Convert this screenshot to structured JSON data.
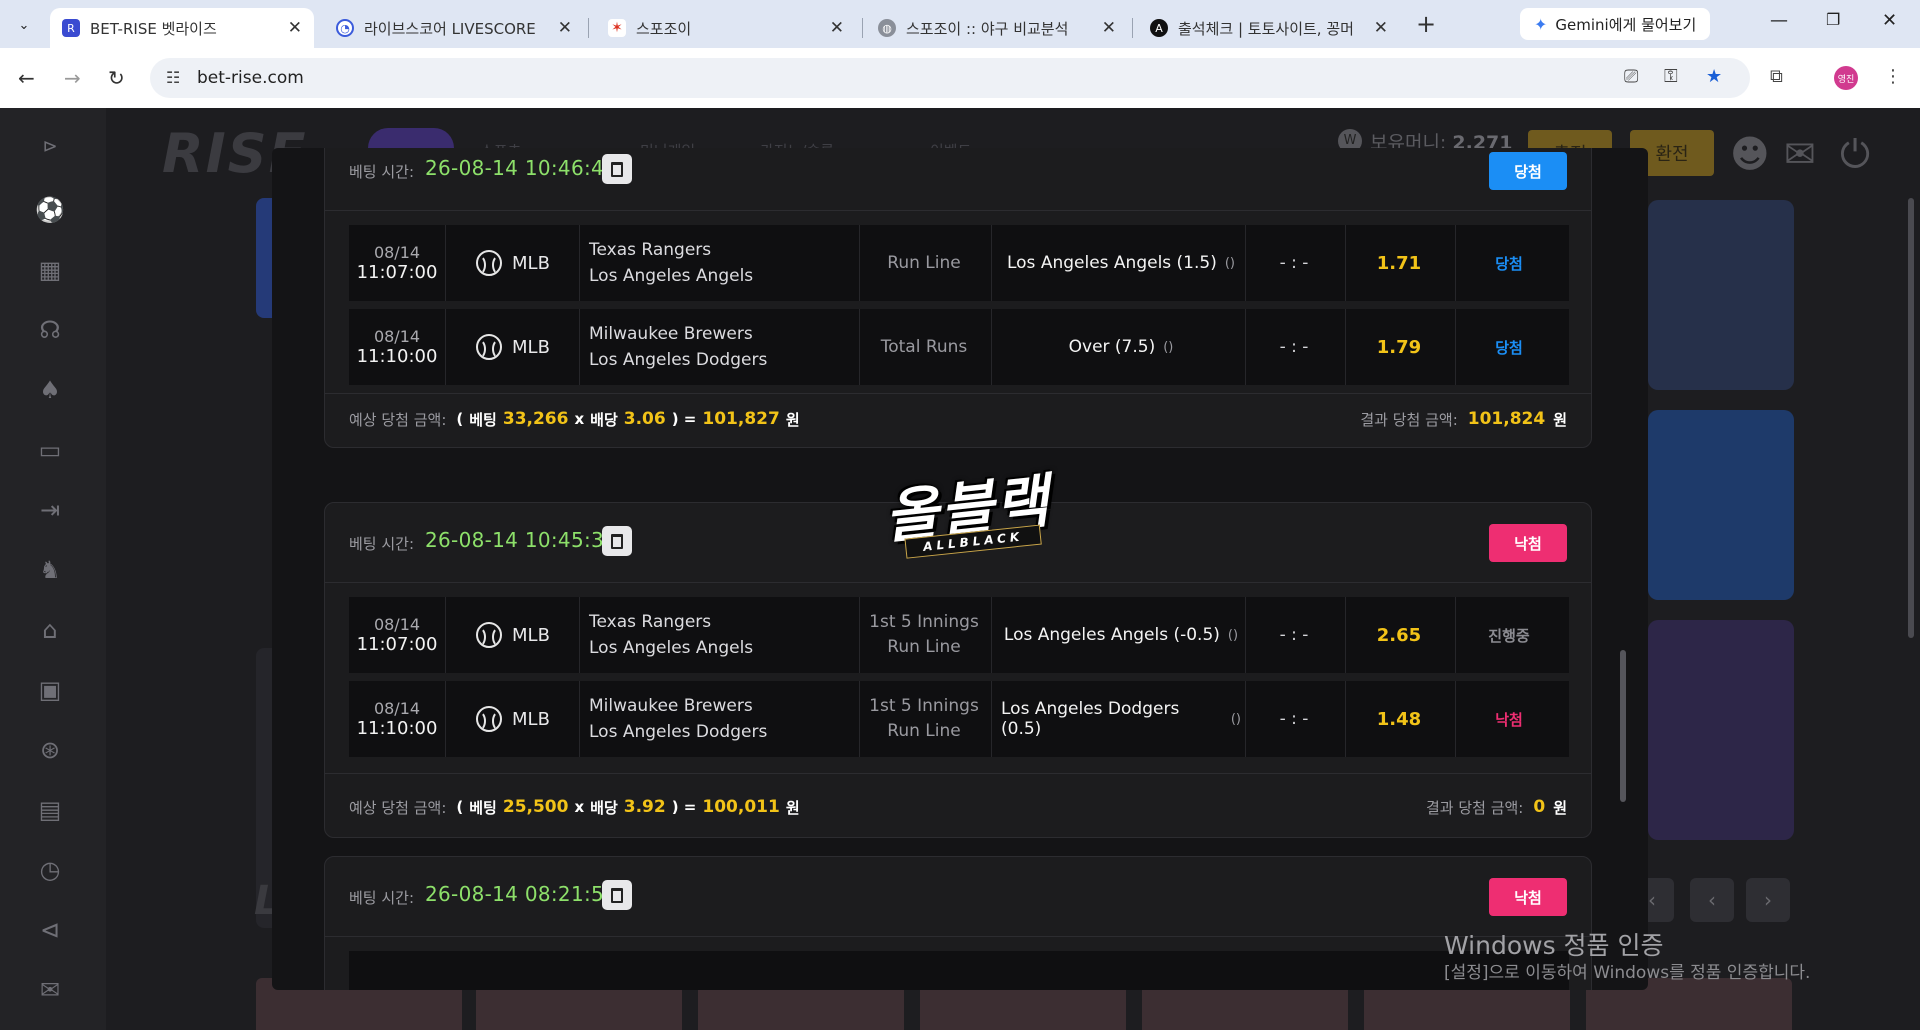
{
  "browser": {
    "tabs": [
      {
        "title": "BET-RISE 벳라이즈",
        "active": true
      },
      {
        "title": "라이브스코어 LIVESCORE"
      },
      {
        "title": "스포조이"
      },
      {
        "title": "스포조이 :: 야구 비교분석"
      },
      {
        "title": "출석체크 | 토토사이트, 꽁머"
      }
    ],
    "gemini_label": "Gemini에게 물어보기",
    "url": "bet-rise.com",
    "profile_label": "영진"
  },
  "site": {
    "logo": "RISE",
    "nav_hint": [
      "스포츠",
      "미니게임",
      "카지노/슬롯",
      "이벤트"
    ],
    "balance_label": "보유머니:",
    "balance_value": "2,271",
    "btn_charge": "충전",
    "btn_exchange": "환전",
    "section_letter": "L"
  },
  "bets": [
    {
      "time_label": "베팅 시간:",
      "time": "26-08-14 10:46:48",
      "status": "당첨",
      "status_color": "#1b8ef5",
      "rows": [
        {
          "date": "08/14",
          "time": "11:07:00",
          "league": "MLB",
          "home": "Texas Rangers",
          "away": "Los Angeles Angels",
          "market": [
            "Run Line"
          ],
          "pick": "Los Angeles Angels (1.5)",
          "pick_paren": "()",
          "score": "- : -",
          "odds": "1.71",
          "result": "당첨",
          "result_color": "#1b8ef5"
        },
        {
          "date": "08/14",
          "time": "11:10:00",
          "league": "MLB",
          "home": "Milwaukee Brewers",
          "away": "Los Angeles Dodgers",
          "market": [
            "Total Runs"
          ],
          "pick": "Over (7.5)",
          "pick_paren": "()",
          "score": "- : -",
          "odds": "1.79",
          "result": "당첨",
          "result_color": "#1b8ef5"
        }
      ],
      "expected_label": "예상 당첨 금액:",
      "bet_word": "베팅",
      "bet_amount": "33,266",
      "odds_word": "배당",
      "total_odds": "3.06",
      "expected": "101,827",
      "won": "원",
      "result_label": "결과 당첨 금액:",
      "result_amount": "101,824"
    },
    {
      "time_label": "베팅 시간:",
      "time": "26-08-14 10:45:34",
      "status": "낙첨",
      "status_color": "#ee2e72",
      "rows": [
        {
          "date": "08/14",
          "time": "11:07:00",
          "league": "MLB",
          "home": "Texas Rangers",
          "away": "Los Angeles Angels",
          "market": [
            "1st 5 Innings",
            "Run Line"
          ],
          "pick": "Los Angeles Angels (-0.5)",
          "pick_paren": "()",
          "score": "- : -",
          "odds": "2.65",
          "result": "진행중",
          "result_color": "#8c8c92"
        },
        {
          "date": "08/14",
          "time": "11:10:00",
          "league": "MLB",
          "home": "Milwaukee Brewers",
          "away": "Los Angeles Dodgers",
          "market": [
            "1st 5 Innings",
            "Run Line"
          ],
          "pick": "Los Angeles Dodgers (0.5)",
          "pick_paren": "()",
          "score": "- : -",
          "odds": "1.48",
          "result": "낙첨",
          "result_color": "#ee2e72"
        }
      ],
      "expected_label": "예상 당첨 금액:",
      "bet_word": "베팅",
      "bet_amount": "25,500",
      "odds_word": "배당",
      "total_odds": "3.92",
      "expected": "100,011",
      "won": "원",
      "result_label": "결과 당첨 금액:",
      "result_amount": "0"
    },
    {
      "time_label": "베팅 시간:",
      "time": "26-08-14 08:21:51",
      "status": "낙첨",
      "status_color": "#ee2e72"
    }
  ],
  "watermark": {
    "main": "올블랙",
    "sub": "ALLBLACK"
  },
  "windows_activation": {
    "title": "Windows 정품 인증",
    "subtitle": "[설정]으로 이동하여 Windows를 정품 인증합니다."
  }
}
